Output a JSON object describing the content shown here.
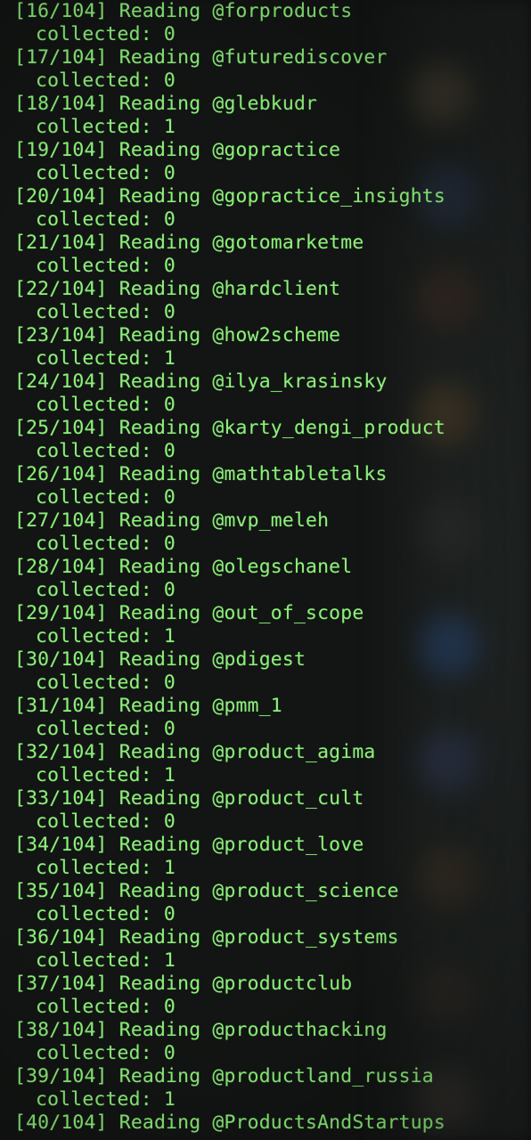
{
  "colors": {
    "background": "#121513",
    "text": "#8df07a"
  },
  "log": [
    {
      "progress": "[16/104]",
      "verb": "Reading",
      "channel": "@forproducts",
      "collected_label": "collected:",
      "collected": "0"
    },
    {
      "progress": "[17/104]",
      "verb": "Reading",
      "channel": "@futurediscover",
      "collected_label": "collected:",
      "collected": "0"
    },
    {
      "progress": "[18/104]",
      "verb": "Reading",
      "channel": "@glebkudr",
      "collected_label": "collected:",
      "collected": "1"
    },
    {
      "progress": "[19/104]",
      "verb": "Reading",
      "channel": "@gopractice",
      "collected_label": "collected:",
      "collected": "0"
    },
    {
      "progress": "[20/104]",
      "verb": "Reading",
      "channel": "@gopractice_insights",
      "collected_label": "collected:",
      "collected": "0"
    },
    {
      "progress": "[21/104]",
      "verb": "Reading",
      "channel": "@gotomarketme",
      "collected_label": "collected:",
      "collected": "0"
    },
    {
      "progress": "[22/104]",
      "verb": "Reading",
      "channel": "@hardclient",
      "collected_label": "collected:",
      "collected": "0"
    },
    {
      "progress": "[23/104]",
      "verb": "Reading",
      "channel": "@how2scheme",
      "collected_label": "collected:",
      "collected": "1"
    },
    {
      "progress": "[24/104]",
      "verb": "Reading",
      "channel": "@ilya_krasinsky",
      "collected_label": "collected:",
      "collected": "0"
    },
    {
      "progress": "[25/104]",
      "verb": "Reading",
      "channel": "@karty_dengi_product",
      "collected_label": "collected:",
      "collected": "0"
    },
    {
      "progress": "[26/104]",
      "verb": "Reading",
      "channel": "@mathtabletalks",
      "collected_label": "collected:",
      "collected": "0"
    },
    {
      "progress": "[27/104]",
      "verb": "Reading",
      "channel": "@mvp_meleh",
      "collected_label": "collected:",
      "collected": "0"
    },
    {
      "progress": "[28/104]",
      "verb": "Reading",
      "channel": "@olegschanel",
      "collected_label": "collected:",
      "collected": "0"
    },
    {
      "progress": "[29/104]",
      "verb": "Reading",
      "channel": "@out_of_scope",
      "collected_label": "collected:",
      "collected": "1"
    },
    {
      "progress": "[30/104]",
      "verb": "Reading",
      "channel": "@pdigest",
      "collected_label": "collected:",
      "collected": "0"
    },
    {
      "progress": "[31/104]",
      "verb": "Reading",
      "channel": "@pmm_1",
      "collected_label": "collected:",
      "collected": "0"
    },
    {
      "progress": "[32/104]",
      "verb": "Reading",
      "channel": "@product_agima",
      "collected_label": "collected:",
      "collected": "1"
    },
    {
      "progress": "[33/104]",
      "verb": "Reading",
      "channel": "@product_cult",
      "collected_label": "collected:",
      "collected": "0"
    },
    {
      "progress": "[34/104]",
      "verb": "Reading",
      "channel": "@product_love",
      "collected_label": "collected:",
      "collected": "1"
    },
    {
      "progress": "[35/104]",
      "verb": "Reading",
      "channel": "@product_science",
      "collected_label": "collected:",
      "collected": "0"
    },
    {
      "progress": "[36/104]",
      "verb": "Reading",
      "channel": "@product_systems",
      "collected_label": "collected:",
      "collected": "1"
    },
    {
      "progress": "[37/104]",
      "verb": "Reading",
      "channel": "@productclub",
      "collected_label": "collected:",
      "collected": "0"
    },
    {
      "progress": "[38/104]",
      "verb": "Reading",
      "channel": "@producthacking",
      "collected_label": "collected:",
      "collected": "0"
    },
    {
      "progress": "[39/104]",
      "verb": "Reading",
      "channel": "@productland_russia",
      "collected_label": "collected:",
      "collected": "1"
    },
    {
      "progress": "[40/104]",
      "verb": "Reading",
      "channel": "@ProductsAndStartups",
      "collected_label": "",
      "collected": ""
    }
  ]
}
